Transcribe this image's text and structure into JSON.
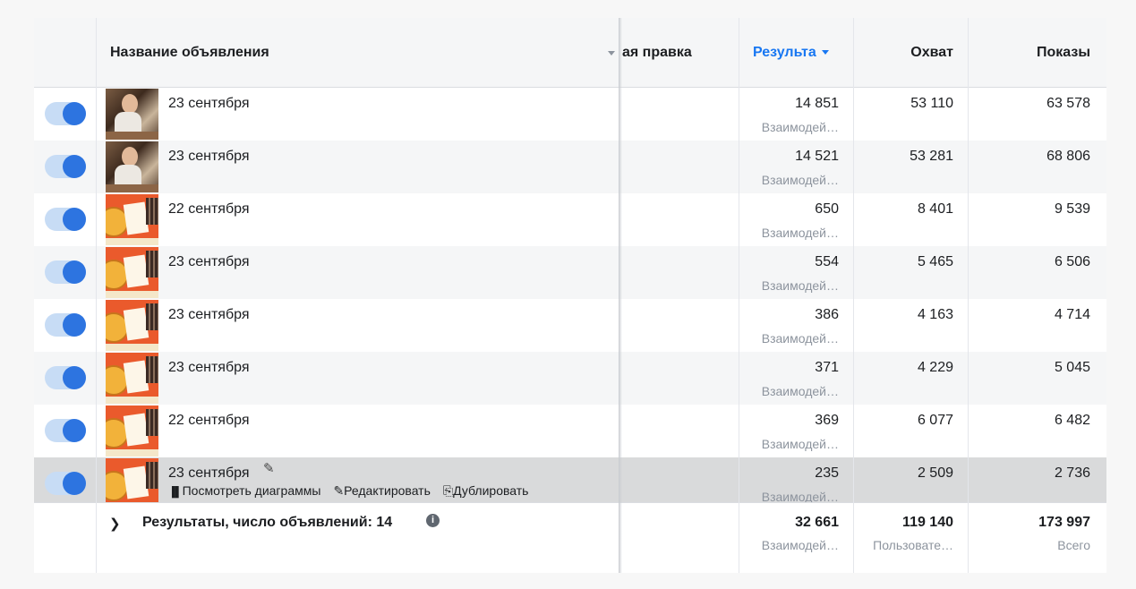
{
  "header": {
    "col_name": "Название объявления",
    "col_partial": "ая правка",
    "col_results": "Результа",
    "col_reach": "Охват",
    "col_impressions": "Показы"
  },
  "colors": {
    "toggle_on": "#2d74e0",
    "toggle_track": "#c7dcf5",
    "results_header": "#1877f2"
  },
  "rows": [
    {
      "name": "23 сентября",
      "image": "boy-photo",
      "results": "14 851",
      "results_sub": "Взаимодей…",
      "reach": "53 110",
      "impressions": "63 578"
    },
    {
      "name": "23 сентября",
      "image": "boy-photo",
      "results": "14 521",
      "results_sub": "Взаимодей…",
      "reach": "53 281",
      "impressions": "68 806"
    },
    {
      "name": "22 сентября",
      "image": "pizza-ad",
      "results": "650",
      "results_sub": "Взаимодей…",
      "reach": "8 401",
      "impressions": "9 539"
    },
    {
      "name": "23 сентября",
      "image": "pizza-ad",
      "results": "554",
      "results_sub": "Взаимодей…",
      "reach": "5 465",
      "impressions": "6 506"
    },
    {
      "name": "23 сентября",
      "image": "pizza-ad",
      "results": "386",
      "results_sub": "Взаимодей…",
      "reach": "4 163",
      "impressions": "4 714"
    },
    {
      "name": "23 сентября",
      "image": "pizza-ad",
      "results": "371",
      "results_sub": "Взаимодей…",
      "reach": "4 229",
      "impressions": "5 045"
    },
    {
      "name": "22 сентября",
      "image": "pizza-ad",
      "results": "369",
      "results_sub": "Взаимодей…",
      "reach": "6 077",
      "impressions": "6 482"
    },
    {
      "name": "23 сентября",
      "image": "pizza-ad",
      "results": "235",
      "results_sub": "Взаимодей…",
      "reach": "2 509",
      "impressions": "2 736"
    }
  ],
  "hover_actions": {
    "charts": "Посмотреть диаграммы",
    "edit": "Редактировать",
    "duplicate": "Дублировать"
  },
  "footer": {
    "label": "Результаты, число объявлений: 14",
    "results": "32 661",
    "results_sub": "Взаимодей…",
    "reach": "119 140",
    "reach_sub": "Пользовате…",
    "impressions": "173 997",
    "impressions_sub": "Всего"
  }
}
